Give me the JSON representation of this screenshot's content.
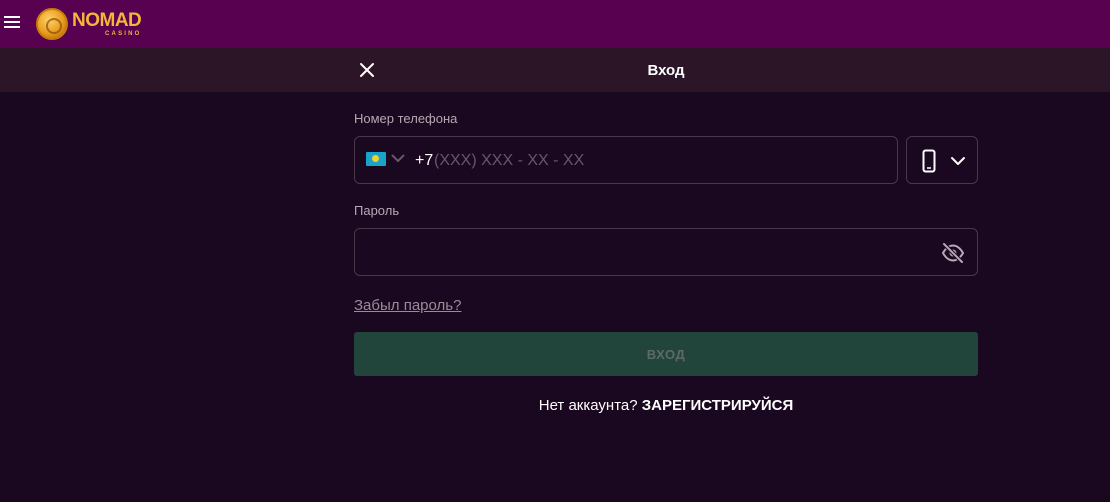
{
  "brand": {
    "name": "NOMAD",
    "sub": "CASINO",
    "color": "#f5b53c"
  },
  "colors": {
    "topbar": "#580150",
    "modal_header": "#2b1527",
    "background": "#1a0720",
    "login_button": "#21453a"
  },
  "modal": {
    "title": "Вход"
  },
  "phone": {
    "label": "Номер телефона",
    "country_flag": "kazakhstan-flag",
    "dial_code": "+7",
    "placeholder": "(XXX) XXX - XX - XX",
    "device_icon": "mobile-phone-icon"
  },
  "password": {
    "label": "Пароль",
    "value": "",
    "visibility_icon": "eye-off-icon"
  },
  "forgot_password": "Забыл пароль?",
  "login_button": "ВХОД",
  "register": {
    "prompt": "Нет аккаунта?",
    "link": "ЗАРЕГИСТРИРУЙСЯ"
  }
}
